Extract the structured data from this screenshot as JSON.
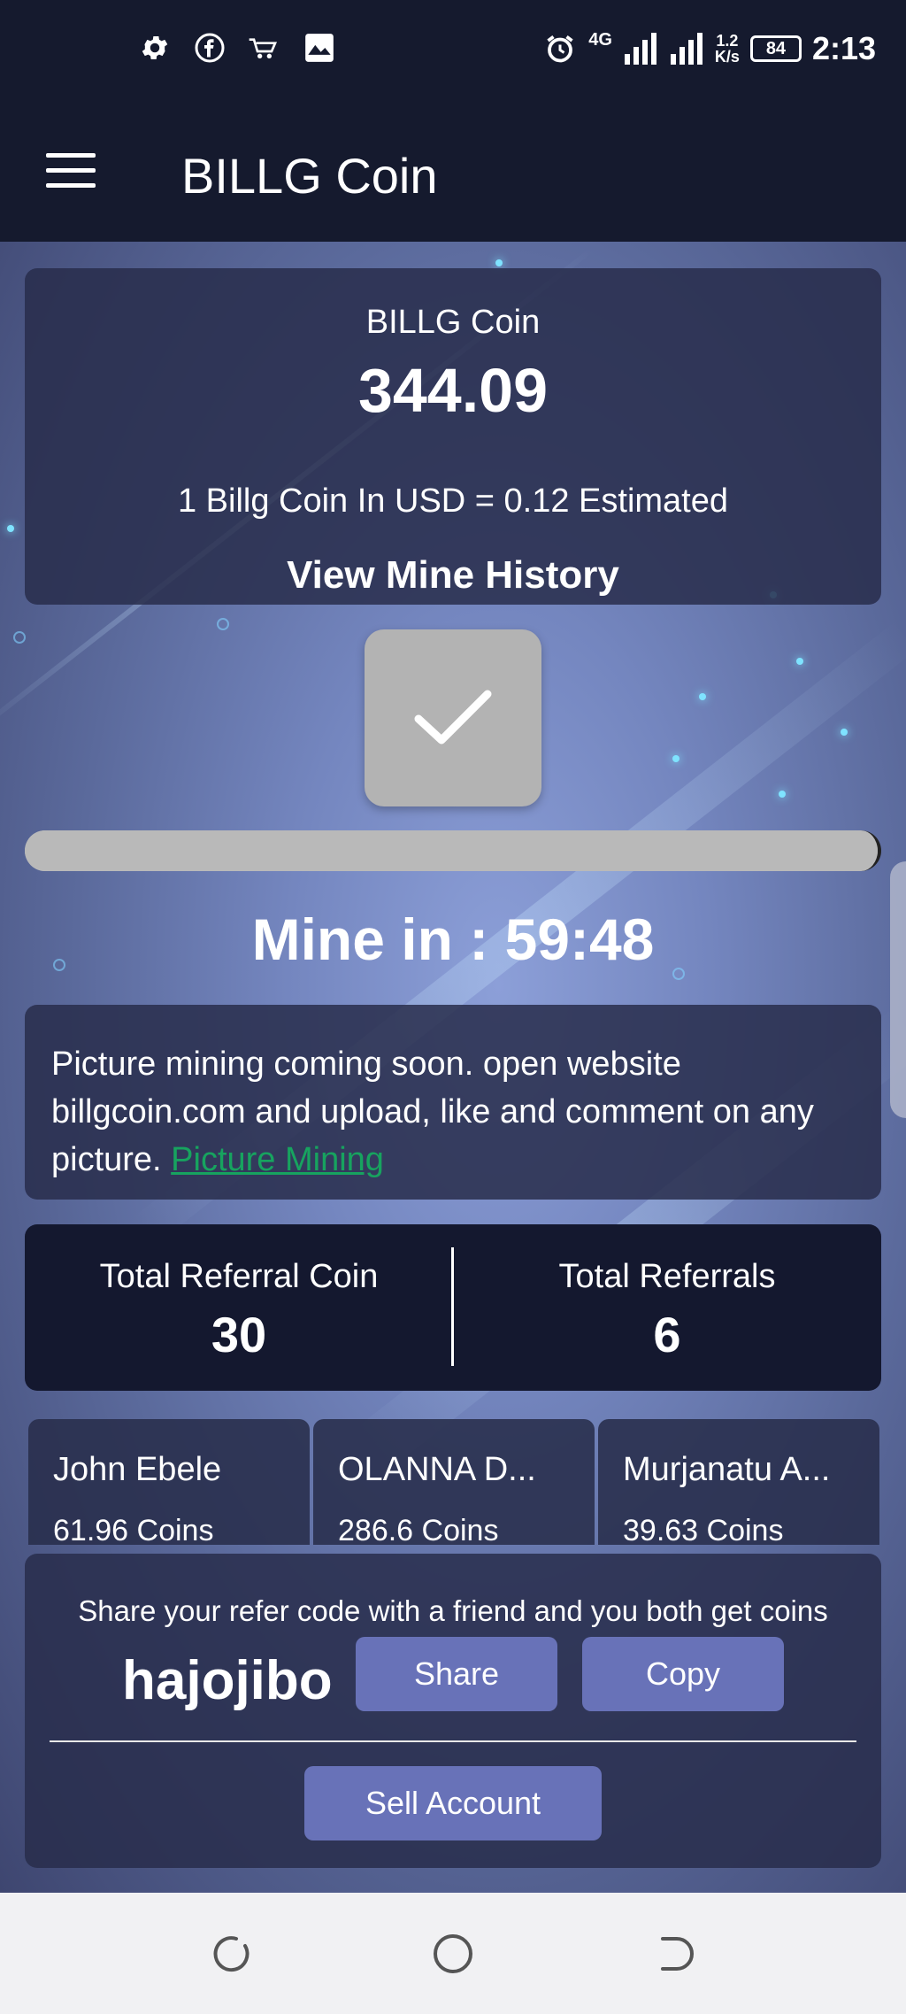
{
  "status_bar": {
    "time": "2:13",
    "network": "4G",
    "speed_value": "1.2",
    "speed_unit": "K/s",
    "battery": "84",
    "left_icons": [
      "settings-icon",
      "facebook-icon",
      "cart-icon",
      "gallery-icon"
    ],
    "right_icons": [
      "alarm-icon",
      "signal-icon",
      "signal-icon",
      "battery-icon"
    ]
  },
  "app_bar": {
    "title": "BILLG Coin"
  },
  "balance_card": {
    "title": "BILLG Coin",
    "balance": "344.09",
    "rate": "1 Billg Coin In USD = 0.12 Estimated",
    "history_link": "View Mine History"
  },
  "mining": {
    "button_icon": "checkmark-icon",
    "progress": 1.0,
    "timer": "Mine in : 59:48"
  },
  "notice": {
    "text": "Picture mining coming soon. open website billgcoin.com and upload, like and comment on any picture. ",
    "link": "Picture Mining"
  },
  "referrals": {
    "coin_label": "Total Referral Coin",
    "coin_value": "30",
    "count_label": "Total Referrals",
    "count_value": "6"
  },
  "referred_users": [
    {
      "name": "John Ebele",
      "coins": "61.96 Coins"
    },
    {
      "name": "OLANNA D...",
      "coins": "286.6 Coins"
    },
    {
      "name": "Murjanatu A...",
      "coins": "39.63 Coins"
    }
  ],
  "share": {
    "text": "Share your refer code with a friend and you both get coins",
    "code": "hajojibo",
    "share_label": "Share",
    "copy_label": "Copy",
    "sell_label": "Sell Account"
  },
  "colors": {
    "bar_bg": "#151a2e",
    "button_accent": "#6872b8",
    "link_green": "#17a35f"
  }
}
